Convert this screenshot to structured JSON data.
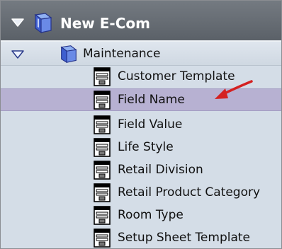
{
  "header": {
    "title": "New E-Com",
    "expander_icon": "triangle-down-icon",
    "folder_icon": "blue-box-icon"
  },
  "section": {
    "label": "Maintenance",
    "expander_icon": "triangle-down-icon",
    "folder_icon": "blue-box-icon"
  },
  "items": [
    {
      "label": "Customer Template",
      "icon": "form-document-icon"
    },
    {
      "label": "Field Name",
      "icon": "form-document-icon",
      "selected": true
    },
    {
      "label": "Field Value",
      "icon": "form-document-icon"
    },
    {
      "label": "Life Style",
      "icon": "form-document-icon"
    },
    {
      "label": "Retail Division",
      "icon": "form-document-icon"
    },
    {
      "label": "Retail Product Category",
      "icon": "form-document-icon"
    },
    {
      "label": "Room Type",
      "icon": "form-document-icon"
    },
    {
      "label": "Setup Sheet Template",
      "icon": "form-document-icon"
    }
  ],
  "annotation": {
    "icon": "red-arrow-icon",
    "color": "#d42121"
  },
  "colors": {
    "header_bg": "#676d74",
    "panel_bg": "#d4dde7",
    "selected_bg": "#b7b1d2",
    "icon_blue": "#4d6fd8"
  }
}
